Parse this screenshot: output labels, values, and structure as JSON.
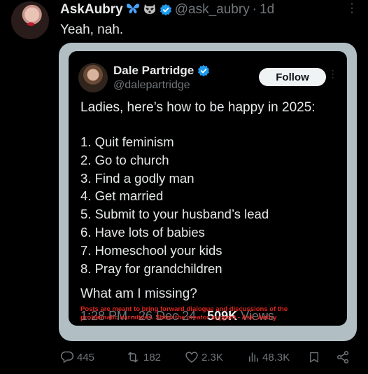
{
  "author": {
    "display_name": "AskAubry",
    "handle": "@ask_aubry",
    "separator": "·",
    "age": "1d",
    "emojis": [
      "butterfly-emoji",
      "raccoon-emoji"
    ],
    "verified": true
  },
  "tweet_text": "Yeah, nah.",
  "embedded_post": {
    "name": "Dale Partridge",
    "handle": "@dalepartridge",
    "follow_label": "Follow",
    "headline": "Ladies, here’s how to be happy in 2025:",
    "items": [
      "1. Quit feminism",
      "2. Go to church",
      "3. Find a godly man",
      "4. Get married",
      "5. Submit to your husband’s lead",
      "6. Have lots of babies",
      "7. Homeschool your kids",
      "8. Pray for grandchildren"
    ],
    "closing": "What am I missing?",
    "timestamp": "1:28 PM · 26 Dec 24 · ",
    "views": "509K",
    "views_label": " Views",
    "disclaimer_line1": "Posts are meant to bring forward dialogue and discussions of the",
    "disclaimer_line2": "problematic narratives. Show the creator support - Ask_Aubry"
  },
  "actions": {
    "replies": "445",
    "reposts": "182",
    "likes": "2.3K",
    "views": "48.3K"
  },
  "colors": {
    "background": "#000000",
    "frame": "#b1bfc4",
    "verified_blue": "#1d9bf0",
    "muted": "#71767b",
    "disclaimer_red": "#e0261f"
  }
}
